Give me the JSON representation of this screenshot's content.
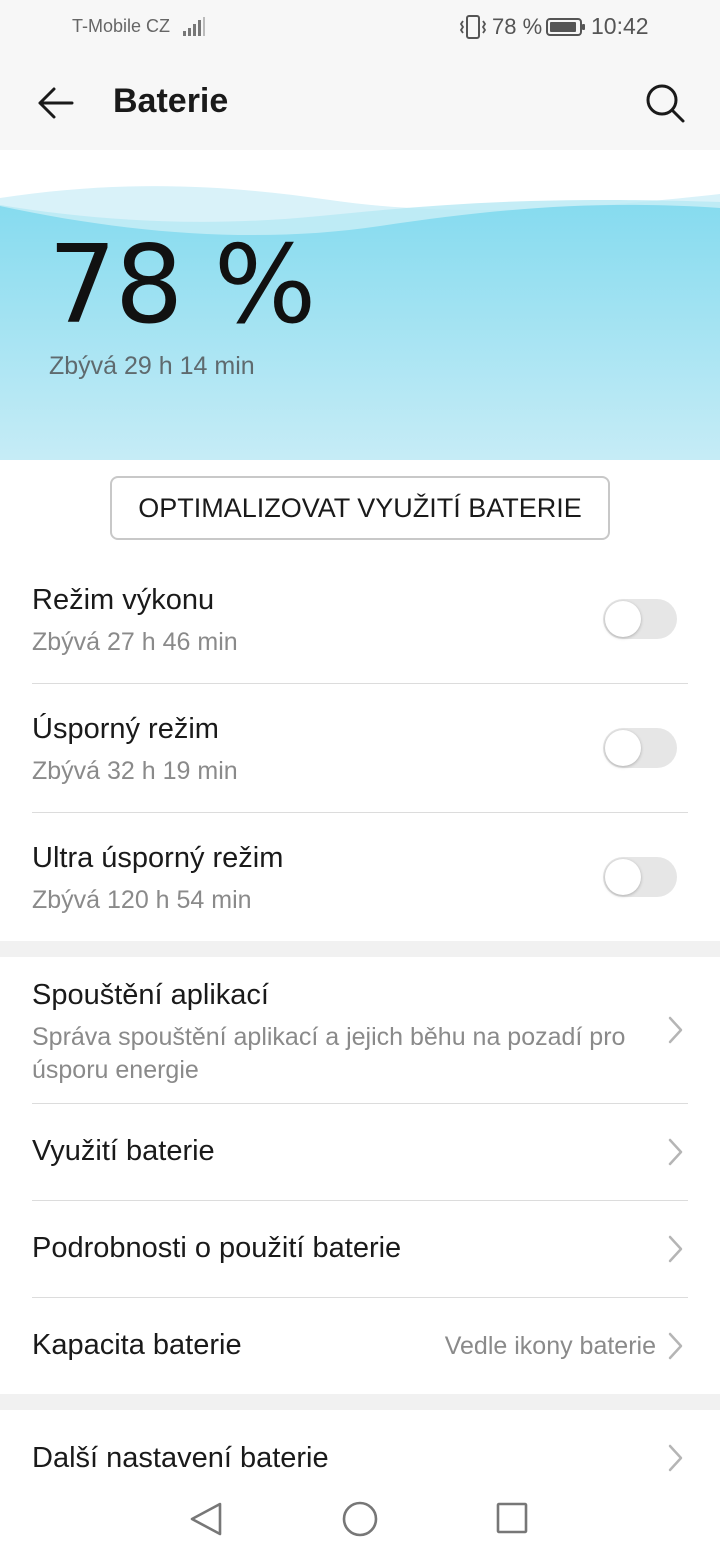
{
  "status_bar": {
    "carrier": "T-Mobile CZ",
    "battery_percent": "78 %",
    "time": "10:42",
    "icons": [
      "signal-icon",
      "vibrate-icon",
      "battery-icon"
    ]
  },
  "app_bar": {
    "title": "Baterie",
    "icons": [
      "back-arrow-icon",
      "search-icon"
    ]
  },
  "hero": {
    "percent": "78 %",
    "battery_level": 0.78,
    "remaining": "Zbývá 29 h 14 min",
    "colors": {
      "wave_top": "#86dbef",
      "wave_bottom": "#c6ecf6"
    }
  },
  "optimize_button": "OPTIMALIZOVAT VYUŽITÍ BATERIE",
  "power_modes": [
    {
      "title": "Režim výkonu",
      "subtitle": "Zbývá 27 h 46 min",
      "enabled": false
    },
    {
      "title": "Úsporný režim",
      "subtitle": "Zbývá 32 h 19 min",
      "enabled": false
    },
    {
      "title": "Ultra úsporný režim",
      "subtitle": "Zbývá 120 h 54 min",
      "enabled": false
    }
  ],
  "settings": [
    {
      "title": "Spouštění aplikací",
      "description": "Správa spouštění aplikací a jejich běhu na pozadí pro úsporu energie"
    },
    {
      "title": "Využití baterie"
    },
    {
      "title": "Podrobnosti o použití baterie"
    },
    {
      "title": "Kapacita baterie",
      "value": "Vedle ikony baterie"
    }
  ],
  "more_settings": {
    "title": "Další nastavení baterie"
  },
  "nav_bar": {
    "icons": [
      "nav-back-icon",
      "nav-home-icon",
      "nav-recents-icon"
    ]
  }
}
